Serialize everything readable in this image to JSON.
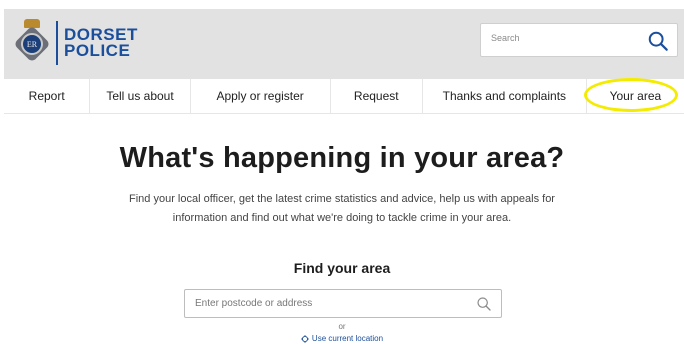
{
  "header": {
    "logo_line1": "DORSET",
    "logo_line2": "POLICE",
    "badge_monogram": "ER",
    "search_placeholder": "Search"
  },
  "nav": {
    "items": [
      {
        "label": "Report"
      },
      {
        "label": "Tell us about"
      },
      {
        "label": "Apply or register"
      },
      {
        "label": "Request"
      },
      {
        "label": "Thanks and complaints"
      },
      {
        "label": "Your area"
      }
    ],
    "highlighted_item": "Your area",
    "highlight_color": "#f4ec00"
  },
  "main": {
    "headline": "What's happening in your area?",
    "intro": "Find your local officer, get the latest crime statistics and advice, help us with appeals for information and find out what we're doing to tackle crime in your area.",
    "find_title": "Find your area",
    "address_placeholder": "Enter postcode or address",
    "or_text": "or",
    "current_location_label": "Use current location"
  },
  "icons": {
    "header_search": "search-icon",
    "address_search": "search-icon",
    "location": "location-target-icon",
    "badge": "police-badge-icon"
  },
  "colors": {
    "brand_blue": "#1b4f9c",
    "header_bg": "#e2e2e2"
  }
}
